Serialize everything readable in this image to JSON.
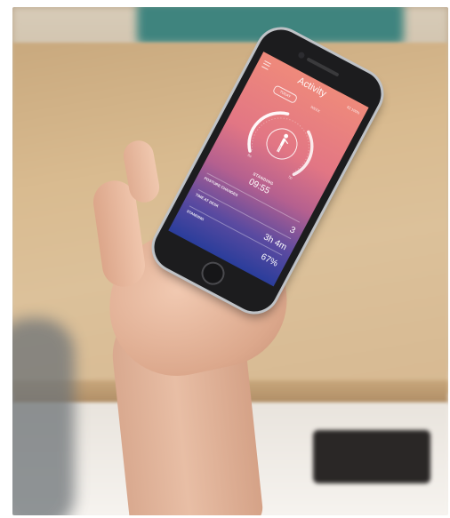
{
  "app": {
    "title": "Activity",
    "status_right": "82 100%"
  },
  "toggle": {
    "today_label": "TODAY",
    "week_label": "WEEK"
  },
  "gauge": {
    "left_tick": "8a",
    "right_tick": "5p"
  },
  "status": {
    "label": "STANDING",
    "time": "09:55"
  },
  "stats": [
    {
      "label": "POSTURE CHANGES",
      "value": "3"
    },
    {
      "label": "TIME AT DESK",
      "value": "3h 4m"
    },
    {
      "label": "STANDING",
      "value": "67%"
    }
  ],
  "colors": {
    "screen_top": "#ef8a7b",
    "screen_bottom": "#2a3d9b",
    "desk": "#d9bb90"
  }
}
